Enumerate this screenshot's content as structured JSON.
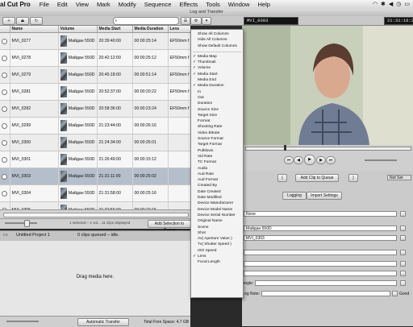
{
  "menubar": {
    "app_name": "al Cut Pro",
    "items": [
      "File",
      "Edit",
      "View",
      "Mark",
      "Modify",
      "Sequence",
      "Effects",
      "Tools",
      "Window",
      "Help"
    ]
  },
  "window": {
    "title": "Log and Transfer"
  },
  "viewer_header": {
    "clip_name": "MVI_0303",
    "timecode": "21:31:16:23"
  },
  "browser": {
    "columns": [
      "Name",
      "Volume",
      "Media Start",
      "Media Duration",
      "Lens"
    ],
    "rows": [
      {
        "name": "MVI_0277",
        "volume": "Майдан 550D",
        "start": "20:39:40:00",
        "duration": "00:00:25:14",
        "lens": "EF50mm f"
      },
      {
        "name": "MVI_0278",
        "volume": "Майдан 550D",
        "start": "20:42:12:00",
        "duration": "00:00:25:12",
        "lens": "EF50mm f"
      },
      {
        "name": "MVI_0279",
        "volume": "Майдан 550D",
        "start": "20:45:18:00",
        "duration": "00:00:51:14",
        "lens": "EF50mm f"
      },
      {
        "name": "MVI_0281",
        "volume": "Майдан 550D",
        "start": "20:52:37:00",
        "duration": "00:00:20:22",
        "lens": "EF50mm f"
      },
      {
        "name": "MVI_0282",
        "volume": "Майдан 550D",
        "start": "20:58:36:00",
        "duration": "00:00:23:24",
        "lens": "EF50mm f"
      },
      {
        "name": "MVI_0299",
        "volume": "Майдан 550D",
        "start": "21:23:44:00",
        "duration": "00:00:26:16",
        "lens": ""
      },
      {
        "name": "MVI_0300",
        "volume": "Майдан 550D",
        "start": "21:24:34:00",
        "duration": "00:00:26:01",
        "lens": ""
      },
      {
        "name": "MVI_0301",
        "volume": "Майдан 550D",
        "start": "21:26:49:00",
        "duration": "00:00:15:12",
        "lens": ""
      },
      {
        "name": "MVI_0303",
        "volume": "Майдан 550D",
        "start": "21:31:11:00",
        "duration": "00:00:25:02",
        "lens": ""
      },
      {
        "name": "MVI_0304",
        "volume": "Майдан 550D",
        "start": "21:31:58:00",
        "duration": "00:00:25:16",
        "lens": ""
      },
      {
        "name": "MVI_0305",
        "volume": "Майдан 550D",
        "start": "21:32:56:00",
        "duration": "00:00:22:15",
        "lens": ""
      }
    ],
    "selected_row": "MVI_0303",
    "status_text": "1 selected – 1 vol... 11 clips displayed",
    "add_selection_label": "Add Selection to Queue"
  },
  "project": {
    "name": "Untitled Project 1",
    "queue_status": "0 clips queued – idle."
  },
  "queue": {
    "drop_hint": "Drag media here."
  },
  "bottom": {
    "auto_transfer_label": "Automatic Transfer",
    "free_space": "Total Free Space: 4.7 GB"
  },
  "transport": {
    "add_clip_label": "Add Clip to Queue",
    "not_set": "Not Set"
  },
  "logging": {
    "tabs": [
      "Logging",
      "Import Settings"
    ],
    "none_value": "None",
    "volume_value": "Майдан 550D",
    "clip_value": "MVI_0303",
    "angle_label": "Angle:",
    "log_note_label": "Log Note:",
    "good_label": "Good"
  },
  "column_menu": {
    "top_items": [
      {
        "label": "Show All Columns",
        "checked": false
      },
      {
        "label": "Hide All Columns",
        "checked": false
      },
      {
        "label": "Show Default Columns",
        "checked": false
      }
    ],
    "items": [
      {
        "label": "Media Map",
        "checked": true
      },
      {
        "label": "Thumbnail",
        "checked": true
      },
      {
        "label": "Volume",
        "checked": true
      },
      {
        "label": "Media Start",
        "checked": true
      },
      {
        "label": "Media End",
        "checked": false
      },
      {
        "label": "Media Duration",
        "checked": true
      },
      {
        "label": "In",
        "checked": false
      },
      {
        "label": "Out",
        "checked": false
      },
      {
        "label": "Duration",
        "checked": false
      },
      {
        "label": "Source Size",
        "checked": false
      },
      {
        "label": "Target Size",
        "checked": false
      },
      {
        "label": "Format",
        "checked": false
      },
      {
        "label": "Shooting Rate",
        "checked": false
      },
      {
        "label": "Video Bitrate",
        "checked": false
      },
      {
        "label": "Source Format",
        "checked": false
      },
      {
        "label": "Target Format",
        "checked": false
      },
      {
        "label": "Pulldown",
        "checked": false
      },
      {
        "label": "Vid Rate",
        "checked": false
      },
      {
        "label": "TC Format",
        "checked": false
      },
      {
        "label": "Audio",
        "checked": false
      },
      {
        "label": "Aud Rate",
        "checked": false
      },
      {
        "label": "Aud Format",
        "checked": false
      },
      {
        "label": "Created By",
        "checked": false
      },
      {
        "label": "Date Created",
        "checked": false
      },
      {
        "label": "Date Modified",
        "checked": false
      },
      {
        "label": "Device Manufacturer",
        "checked": false
      },
      {
        "label": "Device Model Name",
        "checked": false
      },
      {
        "label": "Device Serial Number",
        "checked": false
      },
      {
        "label": "Original Name",
        "checked": false
      },
      {
        "label": "Scene",
        "checked": false
      },
      {
        "label": "Shot",
        "checked": false
      },
      {
        "label": "Av( Aperture Value )",
        "checked": false
      },
      {
        "label": "Tv( Shutter Speed )",
        "checked": false
      },
      {
        "label": "ISO Speed",
        "checked": false
      },
      {
        "label": "Lens",
        "checked": true
      },
      {
        "label": "Focal Length",
        "checked": false
      }
    ]
  }
}
